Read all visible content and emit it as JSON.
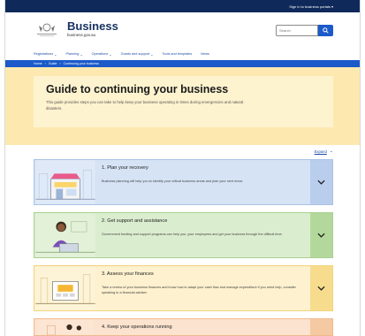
{
  "topbar": {
    "link": "Sign in to business portals ▾"
  },
  "header": {
    "brand_name": "Business",
    "brand_url": "business.gov.au",
    "search_placeholder": "Search"
  },
  "nav": {
    "items": [
      {
        "label": "Registrations"
      },
      {
        "label": "Planning"
      },
      {
        "label": "Operations"
      },
      {
        "label": "Grants and support"
      },
      {
        "label": "Tools and templates"
      },
      {
        "label": "News"
      }
    ]
  },
  "breadcrumb": {
    "items": [
      "Home",
      "Guide",
      "Continuing your business"
    ],
    "separator": "›"
  },
  "hero": {
    "title": "Guide to continuing your business",
    "intro": "This guide provides steps you can take to help keep your business operating in times during emergencies and natural disasters."
  },
  "controls": {
    "collapse_label": "Expand"
  },
  "cards": [
    {
      "title": "1. Plan your recovery",
      "desc": "Business planning will help you to identify your critical business areas and plan your next move.",
      "colors": {
        "bg": "#d6e3f5",
        "border": "#a9c2e6",
        "toggle": "#b9cdec"
      }
    },
    {
      "title": "2. Get support and assistance",
      "desc": "Government funding and support programs can help you, your employees and get your business through the difficult time.",
      "colors": {
        "bg": "#dbedcf",
        "border": "#a8d090",
        "toggle": "#b3d89c"
      }
    },
    {
      "title": "3. Assess your finances",
      "desc": "Take a review of your business finances and know how to adapt your cash flow and manage expenditure if you need help, consider speaking to a financial adviser.",
      "colors": {
        "bg": "#fdf1cf",
        "border": "#f3d27a",
        "toggle": "#f7dc8e"
      }
    },
    {
      "title": "4. Keep your operations running",
      "desc": "",
      "colors": {
        "bg": "#fbe3cf",
        "border": "#f1b98b",
        "toggle": "#f5c9a2"
      }
    }
  ],
  "icons": [
    "crest-icon",
    "search-icon",
    "chevron-down-icon"
  ]
}
